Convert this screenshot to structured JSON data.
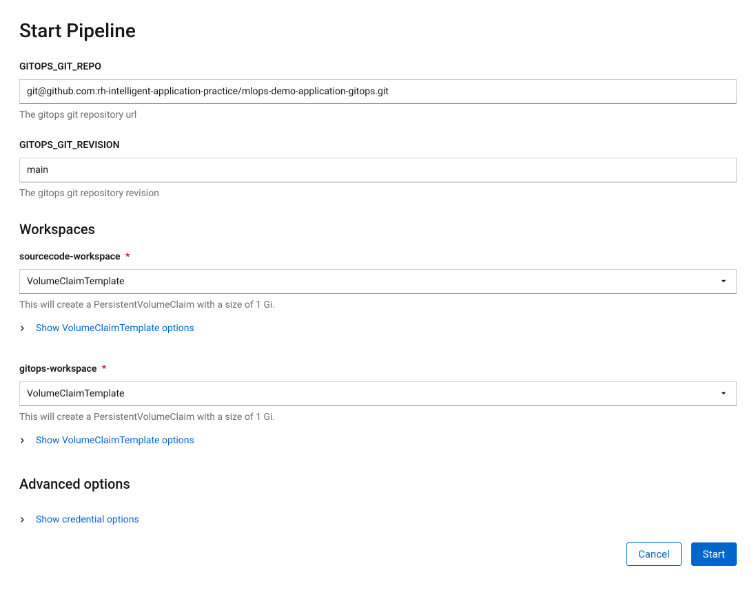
{
  "header": {
    "title": "Start Pipeline"
  },
  "parameters": {
    "gitops_git_repo": {
      "label": "GITOPS_GIT_REPO",
      "value": "git@github.com:rh-intelligent-application-practice/mlops-demo-application-gitops.git",
      "help": "The gitops git repository url"
    },
    "gitops_git_revision": {
      "label": "GITOPS_GIT_REVISION",
      "value": "main",
      "help": "The gitops git repository revision"
    }
  },
  "workspaces": {
    "title": "Workspaces",
    "items": [
      {
        "label": "sourcecode-workspace",
        "select_value": "VolumeClaimTemplate",
        "help": "This will create a PersistentVolumeClaim with a size of 1 Gi.",
        "expand_label": "Show VolumeClaimTemplate options"
      },
      {
        "label": "gitops-workspace",
        "select_value": "VolumeClaimTemplate",
        "help": "This will create a PersistentVolumeClaim with a size of 1 Gi.",
        "expand_label": "Show VolumeClaimTemplate options"
      }
    ]
  },
  "advanced": {
    "title": "Advanced options",
    "expand_label": "Show credential options"
  },
  "footer": {
    "cancel": "Cancel",
    "start": "Start"
  },
  "required_asterisk": "*"
}
